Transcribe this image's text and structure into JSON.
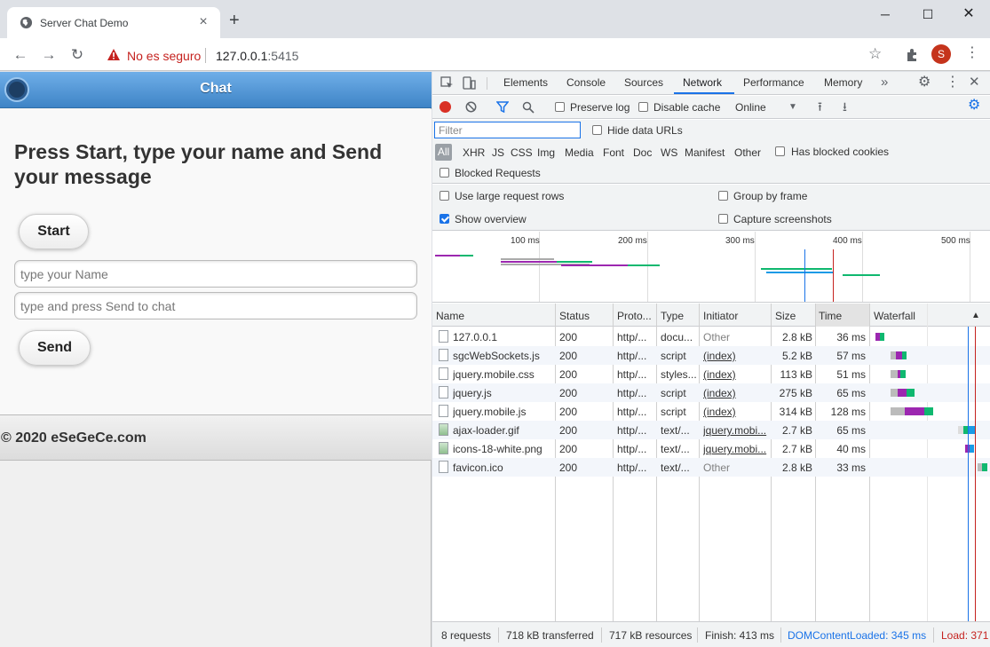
{
  "browser": {
    "tab_title": "Server Chat Demo",
    "insecure_label": "No es seguro",
    "url_host": "127.0.0.1",
    "url_port": ":5415",
    "avatar_letter": "S"
  },
  "page": {
    "header_title": "Chat",
    "headline": "Press Start, type your name and Send your message",
    "start_label": "Start",
    "name_placeholder": "type your Name",
    "message_placeholder": "type and press Send to chat",
    "send_label": "Send",
    "footer_text": "© 2020 eSeGeCe.com",
    "header_color": "#3e84c6"
  },
  "devtools": {
    "tabs": [
      "Elements",
      "Console",
      "Sources",
      "Network",
      "Performance",
      "Memory"
    ],
    "active_tab": "Network",
    "preserve_log": "Preserve log",
    "disable_cache": "Disable cache",
    "throttling": "Online",
    "filter_placeholder": "Filter",
    "hide_data_urls": "Hide data URLs",
    "filter_types": [
      "All",
      "XHR",
      "JS",
      "CSS",
      "Img",
      "Media",
      "Font",
      "Doc",
      "WS",
      "Manifest",
      "Other"
    ],
    "has_blocked_cookies": "Has blocked cookies",
    "blocked_requests": "Blocked Requests",
    "use_large_rows": "Use large request rows",
    "show_overview": "Show overview",
    "group_by_frame": "Group by frame",
    "capture_screenshots": "Capture screenshots",
    "overview_ticks": [
      "100 ms",
      "200 ms",
      "300 ms",
      "400 ms",
      "500 ms"
    ],
    "columns": [
      "Name",
      "Status",
      "Proto...",
      "Type",
      "Initiator",
      "Size",
      "Time",
      "Waterfall"
    ],
    "rows": [
      {
        "name": "127.0.0.1",
        "status": "200",
        "proto": "http/...",
        "type": "docu...",
        "initiator": "Other",
        "size": "2.8 kB",
        "time": "36 ms"
      },
      {
        "name": "sgcWebSockets.js",
        "status": "200",
        "proto": "http/...",
        "type": "script",
        "initiator": "(index)",
        "size": "5.2 kB",
        "time": "57 ms"
      },
      {
        "name": "jquery.mobile.css",
        "status": "200",
        "proto": "http/...",
        "type": "styles...",
        "initiator": "(index)",
        "size": "113 kB",
        "time": "51 ms"
      },
      {
        "name": "jquery.js",
        "status": "200",
        "proto": "http/...",
        "type": "script",
        "initiator": "(index)",
        "size": "275 kB",
        "time": "65 ms"
      },
      {
        "name": "jquery.mobile.js",
        "status": "200",
        "proto": "http/...",
        "type": "script",
        "initiator": "(index)",
        "size": "314 kB",
        "time": "128 ms"
      },
      {
        "name": "ajax-loader.gif",
        "status": "200",
        "proto": "http/...",
        "type": "text/...",
        "initiator": "jquery.mobi...",
        "size": "2.7 kB",
        "time": "65 ms"
      },
      {
        "name": "icons-18-white.png",
        "status": "200",
        "proto": "http/...",
        "type": "text/...",
        "initiator": "jquery.mobi...",
        "size": "2.7 kB",
        "time": "40 ms"
      },
      {
        "name": "favicon.ico",
        "status": "200",
        "proto": "http/...",
        "type": "text/...",
        "initiator": "Other",
        "size": "2.8 kB",
        "time": "33 ms"
      }
    ],
    "summary": {
      "requests": "8 requests",
      "transferred": "718 kB transferred",
      "resources": "717 kB resources",
      "finish": "Finish: 413 ms",
      "dom_loaded": "DOMContentLoaded: 345 ms",
      "load": "Load: 371"
    },
    "colors": {
      "accent": "#1a73e8",
      "record": "#d93025",
      "wait_green": "#0fb86f",
      "download_blue": "#1a9ae6",
      "script_purple": "#9c27b0"
    }
  }
}
